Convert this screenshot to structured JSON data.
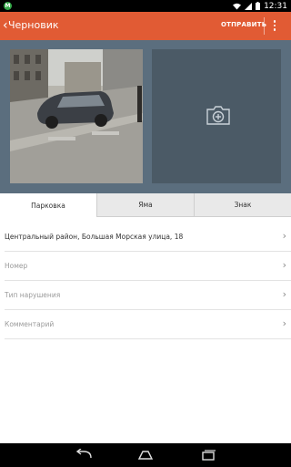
{
  "status_bar": {
    "time": "12:31",
    "app_badge": "М"
  },
  "app_bar": {
    "back_glyph": "‹",
    "title": "Черновик",
    "send_label": "ОТПРАВИТЬ"
  },
  "tabs": [
    {
      "label": "Парковка",
      "active": true
    },
    {
      "label": "Яма",
      "active": false
    },
    {
      "label": "Знак",
      "active": false
    }
  ],
  "form": {
    "address": "Центральный район, Большая Морская улица, 18",
    "number_placeholder": "Номер",
    "violation_placeholder": "Тип нарушения",
    "comment_placeholder": "Комментарий"
  },
  "colors": {
    "accent": "#e15b34",
    "photo_bg": "#5b6e7e"
  }
}
